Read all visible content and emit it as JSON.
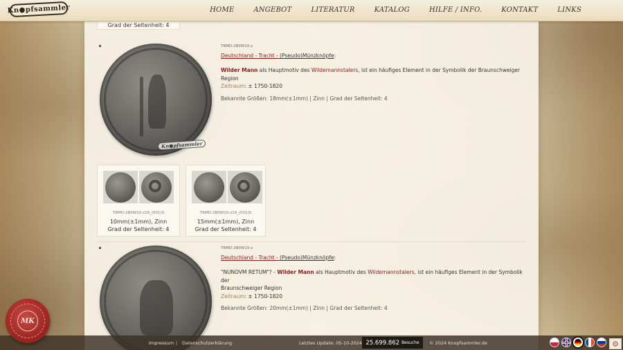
{
  "header": {
    "logo_text": "Kn●pfsammler",
    "nav": [
      "HOME",
      "ANGEBOT",
      "LITERATUR",
      "KATALOG",
      "HILFE / INFO.",
      "KONTAKT",
      "LINKS"
    ]
  },
  "top_card": {
    "rarity": "Grad der Seltenheit: 4"
  },
  "entry1": {
    "code": "TRMD-2B0W10-z",
    "category_link": "Deutschland - Tracht - ",
    "category_sub": "(Pseudo)Münzknöpfe",
    "desc_bold": "Wilder Mann",
    "desc_mid": " als Hauptmotiv des ",
    "desc_red": "Wildemannstalers",
    "desc_end": ", ist ein häufiges Element in der Symbolik der Braunschweiger Region",
    "era_label": "Zeitraum",
    "era_value": ": ± 1750-1820",
    "sizes_label": "Bekannte Größen: ",
    "sizes_value": "18mm(±1mm) | Zinn | Grad der Seltenheit: 4",
    "stamp": "Kn●pfsammler"
  },
  "variants": [
    {
      "code": "TRMD-2B0W10-z18_(001)S",
      "size": "10mm(±1mm), Zinn",
      "rarity": "Grad der Seltenheit: 4"
    },
    {
      "code": "TRMD-2B0W10-z19_(001)S",
      "size": "15mm(±1mm), Zinn",
      "rarity": "Grad der Seltenheit: 4"
    }
  ],
  "entry2": {
    "code": "TRMD-2B0W15-z",
    "category_link": "Deutschland - Tracht - ",
    "category_sub": "(Pseudo)Münzknöpfe",
    "desc_quote": "\"NUNOVM RETUM\"? - ",
    "desc_bold": "Wilder Mann",
    "desc_mid": " als Hauptmotiv des ",
    "desc_red": "Wildemannstalers",
    "desc_end": ", ist ein häufiges Element in der Symbolik der",
    "desc_line2": "Braunschweiger Region",
    "era_label": "Zeitraum",
    "era_value": ": ± 1750-1820",
    "sizes_label": "Bekannte Größen: ",
    "sizes_value": "20mm(±1mm) | Zinn | Grad der Seltenheit: 4"
  },
  "footer": {
    "impressum": "Impressum",
    "sep": "|",
    "datenschutz": "Datenschutzerklärung",
    "last_update": "Letztes Update: 05-10-2024",
    "visits_count": "25.699.862",
    "visits_label": "Besuche",
    "copyright": "© 2024 Knopfsammler.de"
  },
  "seal_text": "MK",
  "colors": {
    "accent": "#8a1b1b",
    "footer_bg": "#3c3024"
  }
}
